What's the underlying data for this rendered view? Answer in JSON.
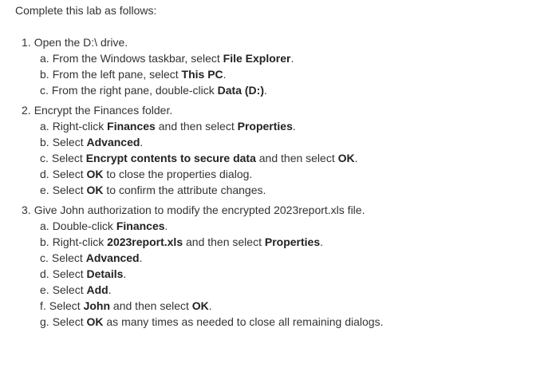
{
  "intro": "Complete this lab as follows:",
  "steps": [
    {
      "num": "1.",
      "text": "Open the D:\\ drive.",
      "substeps": [
        {
          "num": "a.",
          "parts": [
            {
              "t": "From the Windows taskbar, select "
            },
            {
              "t": "File Explorer",
              "b": true
            },
            {
              "t": "."
            }
          ]
        },
        {
          "num": "b.",
          "parts": [
            {
              "t": "From the left pane, select "
            },
            {
              "t": "This PC",
              "b": true
            },
            {
              "t": "."
            }
          ]
        },
        {
          "num": "c.",
          "parts": [
            {
              "t": "From the right pane, double-click "
            },
            {
              "t": "Data (D:)",
              "b": true
            },
            {
              "t": "."
            }
          ]
        }
      ]
    },
    {
      "num": "2.",
      "text": "Encrypt the Finances folder.",
      "substeps": [
        {
          "num": "a.",
          "parts": [
            {
              "t": "Right-click "
            },
            {
              "t": "Finances",
              "b": true
            },
            {
              "t": " and then select "
            },
            {
              "t": "Properties",
              "b": true
            },
            {
              "t": "."
            }
          ]
        },
        {
          "num": "b.",
          "parts": [
            {
              "t": "Select "
            },
            {
              "t": "Advanced",
              "b": true
            },
            {
              "t": "."
            }
          ]
        },
        {
          "num": "c.",
          "parts": [
            {
              "t": "Select "
            },
            {
              "t": "Encrypt contents to secure data",
              "b": true
            },
            {
              "t": " and then select "
            },
            {
              "t": "OK",
              "b": true
            },
            {
              "t": "."
            }
          ]
        },
        {
          "num": "d.",
          "parts": [
            {
              "t": "Select "
            },
            {
              "t": "OK",
              "b": true
            },
            {
              "t": " to close the properties dialog."
            }
          ]
        },
        {
          "num": "e.",
          "parts": [
            {
              "t": "Select "
            },
            {
              "t": "OK",
              "b": true
            },
            {
              "t": " to confirm the attribute changes."
            }
          ]
        }
      ]
    },
    {
      "num": "3.",
      "text": "Give John authorization to modify the encrypted 2023report.xls file.",
      "substeps": [
        {
          "num": "a.",
          "parts": [
            {
              "t": "Double-click "
            },
            {
              "t": "Finances",
              "b": true
            },
            {
              "t": "."
            }
          ]
        },
        {
          "num": "b.",
          "parts": [
            {
              "t": "Right-click "
            },
            {
              "t": "2023report.xls",
              "b": true
            },
            {
              "t": " and then select "
            },
            {
              "t": "Properties",
              "b": true
            },
            {
              "t": "."
            }
          ]
        },
        {
          "num": "c.",
          "parts": [
            {
              "t": "Select "
            },
            {
              "t": "Advanced",
              "b": true
            },
            {
              "t": "."
            }
          ]
        },
        {
          "num": "d.",
          "parts": [
            {
              "t": "Select "
            },
            {
              "t": "Details",
              "b": true
            },
            {
              "t": "."
            }
          ]
        },
        {
          "num": "e.",
          "parts": [
            {
              "t": "Select "
            },
            {
              "t": "Add",
              "b": true
            },
            {
              "t": "."
            }
          ]
        },
        {
          "num": "f.",
          "parts": [
            {
              "t": "Select "
            },
            {
              "t": "John",
              "b": true
            },
            {
              "t": " and then select "
            },
            {
              "t": "OK",
              "b": true
            },
            {
              "t": "."
            }
          ]
        },
        {
          "num": "g.",
          "parts": [
            {
              "t": "Select "
            },
            {
              "t": "OK",
              "b": true
            },
            {
              "t": " as many times as needed to close all remaining dialogs."
            }
          ]
        }
      ]
    }
  ]
}
